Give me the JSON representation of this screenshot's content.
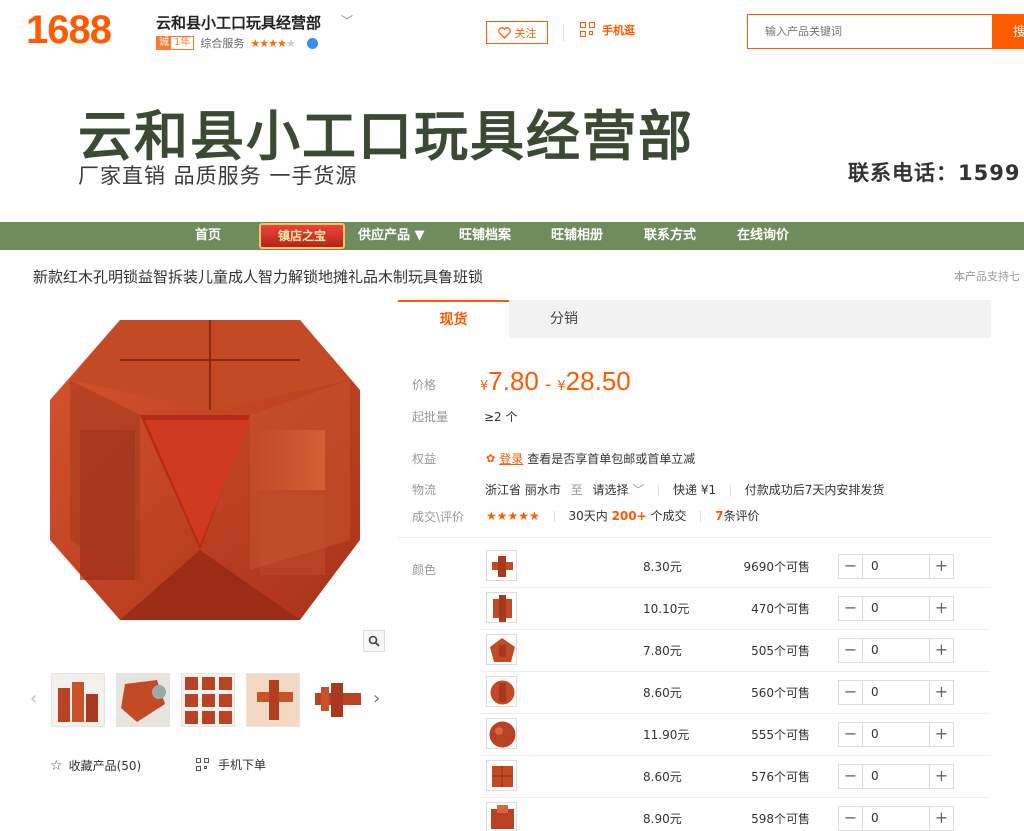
{
  "header": {
    "logo": "1688",
    "shop_name": "云和县小工口玩具经营部",
    "badge_left": "诚",
    "badge_right": "1年",
    "service_label": "综合服务",
    "follow_label": "关注",
    "mobile_label": "手机逛",
    "search_placeholder": "输入产品关键词",
    "search_button": "搜"
  },
  "banner": {
    "title": "云和县小工口玩具经营部",
    "subtitle": "厂家直销 品质服务 一手货源",
    "phone": "联系电话：1599"
  },
  "nav": {
    "items": [
      "首页",
      "供应产品 ▼",
      "旺铺档案",
      "旺铺相册",
      "联系方式",
      "在线询价"
    ],
    "badge": "镇店之宝"
  },
  "product": {
    "title": "新款红木孔明锁益智拆装儿童成人智力解锁地摊礼品木制玩具鲁班锁",
    "support_note": "本产品支持七"
  },
  "tabs": [
    "现货",
    "分销"
  ],
  "info": {
    "price_label": "价格",
    "yen": "¥",
    "price_low": "7.80",
    "price_dash": "-",
    "price_high": "28.50",
    "moq_label": "起批量",
    "moq_value": "≥2 个",
    "rights_label": "权益",
    "login_link": "登录",
    "rights_text": "查看是否享首单包邮或首单立减",
    "logistics_label": "物流",
    "origin": "浙江省 丽水市",
    "to": "至",
    "destination": "请选择",
    "express": "快递 ¥1",
    "ship_note": "付款成功后7天内安排发货",
    "deals_label": "成交\\评价",
    "stars": "★★★★★",
    "days_prefix": "30天内",
    "deals_count": "200+",
    "deals_suffix": "个成交",
    "review_count": "7",
    "review_suffix": "条评价"
  },
  "sku": {
    "label": "颜色",
    "rows": [
      {
        "price": "8.30元",
        "stock": "9690个可售",
        "qty": "0"
      },
      {
        "price": "10.10元",
        "stock": "470个可售",
        "qty": "0"
      },
      {
        "price": "7.80元",
        "stock": "505个可售",
        "qty": "0"
      },
      {
        "price": "8.60元",
        "stock": "560个可售",
        "qty": "0"
      },
      {
        "price": "11.90元",
        "stock": "555个可售",
        "qty": "0"
      },
      {
        "price": "8.60元",
        "stock": "576个可售",
        "qty": "0"
      },
      {
        "price": "8.90元",
        "stock": "598个可售",
        "qty": "0"
      }
    ]
  },
  "gallery": {
    "collect_label": "收藏产品(50)",
    "mobile_order_label": "手机下单"
  },
  "colors": {
    "brand_orange": "#ff5a00",
    "nav_green": "#6f8c5d",
    "banner_text": "#3c4a33"
  }
}
